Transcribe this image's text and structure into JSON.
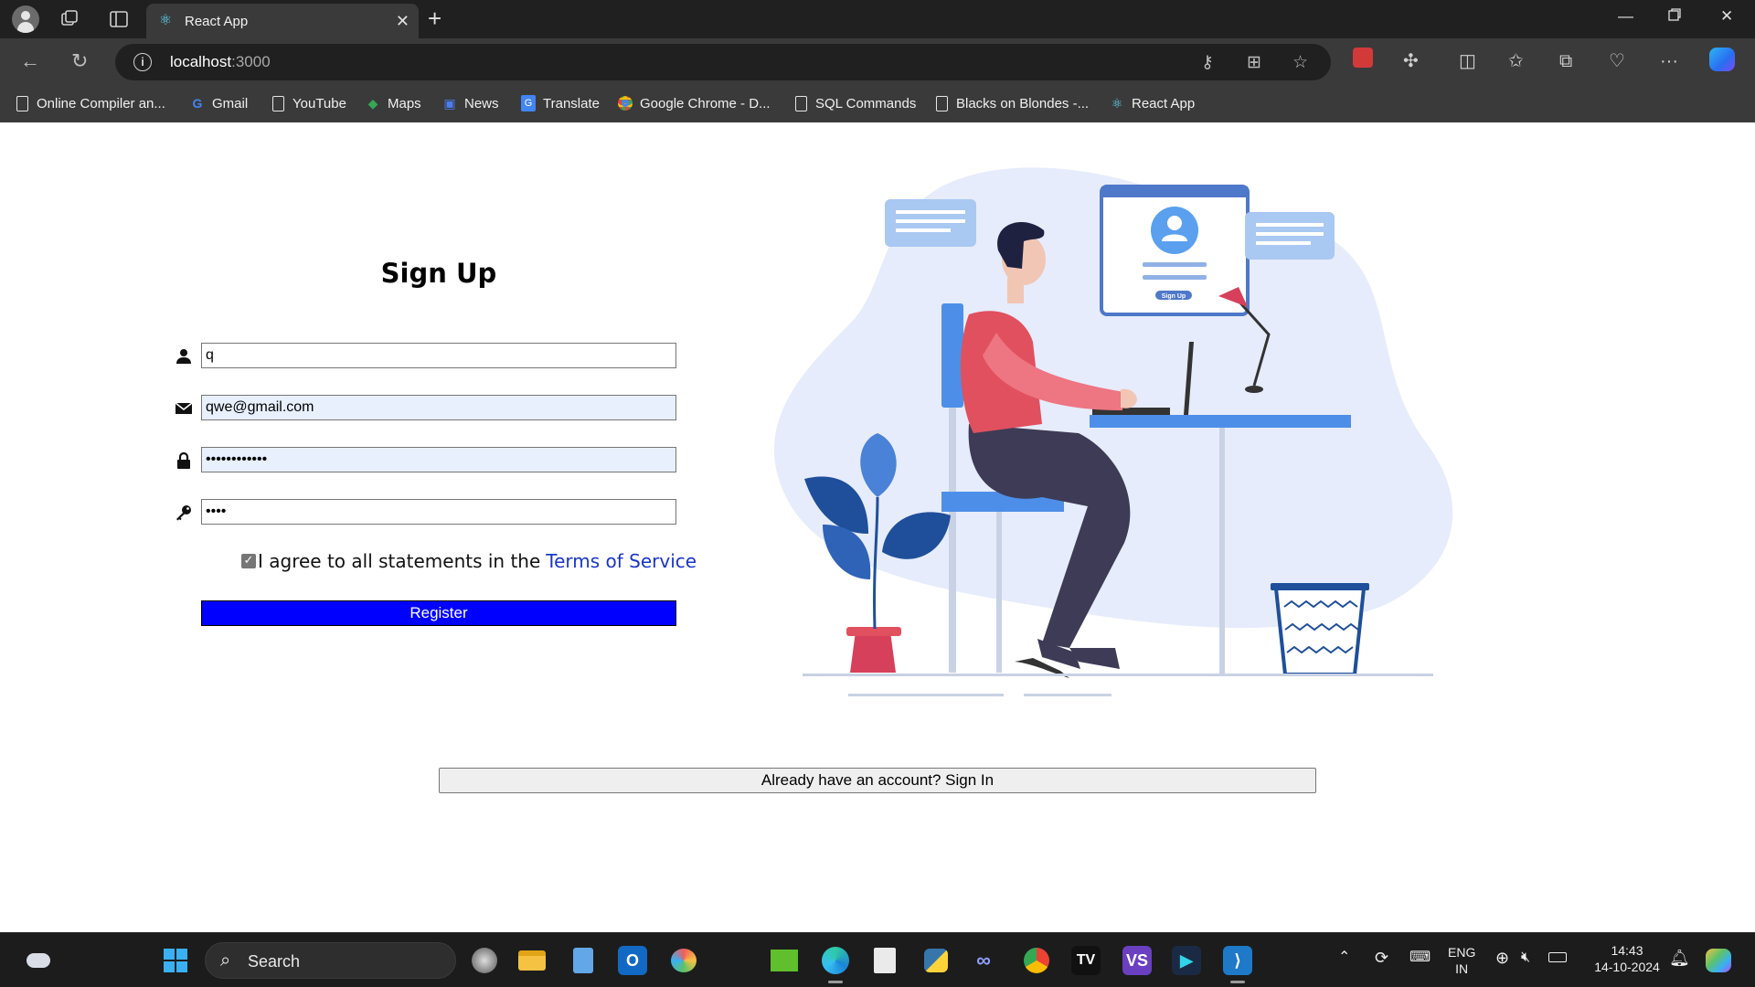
{
  "browser": {
    "tab_title": "React App",
    "url_host": "localhost",
    "url_port": ":3000",
    "bookmarks": [
      {
        "label": "Online Compiler an...",
        "icon": "document-icon"
      },
      {
        "label": "Gmail",
        "icon": "google-icon"
      },
      {
        "label": "YouTube",
        "icon": "document-icon"
      },
      {
        "label": "Maps",
        "icon": "maps-icon"
      },
      {
        "label": "News",
        "icon": "news-icon"
      },
      {
        "label": "Translate",
        "icon": "translate-icon"
      },
      {
        "label": "Google Chrome - D...",
        "icon": "chrome-icon"
      },
      {
        "label": "SQL Commands",
        "icon": "document-icon"
      },
      {
        "label": "Blacks on Blondes -...",
        "icon": "document-icon"
      },
      {
        "label": "React App",
        "icon": "react-icon"
      }
    ]
  },
  "signup": {
    "title": "Sign Up",
    "name_value": "q",
    "email_value": "qwe@gmail.com",
    "password_value": "••••••••••••",
    "confirm_value": "••••",
    "terms_text": "I agree to all statements in the",
    "terms_link": "Terms of Service",
    "terms_checked": true,
    "register_label": "Register",
    "signin_label": "Already have an account? Sign In",
    "illustration_button_label": "Sign Up",
    "register_color": "#0000ff",
    "link_color": "#1a36c8"
  },
  "taskbar": {
    "search_placeholder": "Search",
    "lang_line1": "ENG",
    "lang_line2": "IN",
    "time": "14:43",
    "date": "14-10-2024"
  }
}
